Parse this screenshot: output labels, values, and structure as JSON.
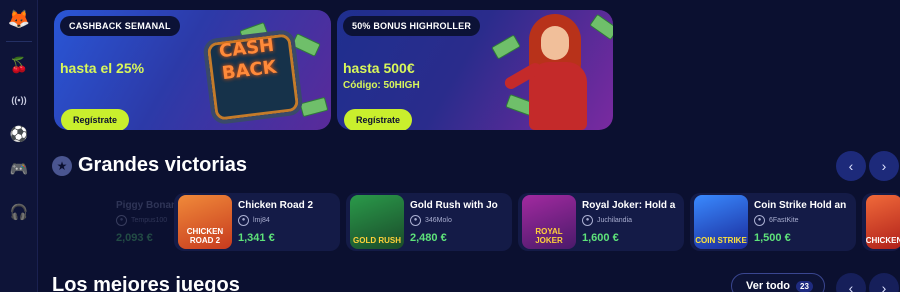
{
  "sidebar": {
    "items": [
      {
        "name": "logo",
        "icon": "🦊"
      },
      {
        "name": "cherries-icon",
        "icon": "🍒"
      },
      {
        "name": "live-icon",
        "icon": "((•))"
      },
      {
        "name": "soccer-icon",
        "icon": "⚽"
      },
      {
        "name": "gamepad-icon",
        "icon": "🎮"
      },
      {
        "name": "headset-icon",
        "icon": "🎧"
      }
    ]
  },
  "promos": [
    {
      "tag": "CASHBACK SEMANAL",
      "headline": "hasta el 25%",
      "sub": "",
      "button": "Regístrate",
      "art_text": "CASH BACK"
    },
    {
      "tag": "50% BONUS HIGHROLLER",
      "headline": "hasta 500€",
      "sub": "Código: 50HIGH",
      "button": "Regístrate"
    }
  ],
  "big_wins": {
    "title": "Grandes victorias",
    "prev": "‹",
    "next": "›",
    "items": [
      {
        "game": "Piggy Bonanza",
        "user": "Tempus100",
        "amount": "2,093 €",
        "thumb_label": "",
        "thumb_color": "#1a2060"
      },
      {
        "game": "Chicken Road 2",
        "user": "lmj84",
        "amount": "1,341 €",
        "thumb_label": "CHICKEN ROAD 2",
        "thumb_color": "#d65a28"
      },
      {
        "game": "Gold Rush with Jo",
        "user": "346Molo",
        "amount": "2,480 €",
        "thumb_label": "GOLD RUSH",
        "thumb_color": "#1d7a3a"
      },
      {
        "game": "Royal Joker: Hold a",
        "user": "Juchilandia",
        "amount": "1,600 €",
        "thumb_label": "ROYAL JOKER",
        "thumb_color": "#7a1d8a"
      },
      {
        "game": "Coin Strike Hold an",
        "user": "6FastKite",
        "amount": "1,500 €",
        "thumb_label": "COIN STRIKE",
        "thumb_color": "#1f6adf"
      },
      {
        "game": "",
        "user": "",
        "amount": "",
        "thumb_label": "CHICKEN",
        "thumb_color": "#d63a2a"
      }
    ]
  },
  "best_games": {
    "title": "Los mejores juegos",
    "view_all": "Ver todo",
    "count": "23",
    "prev": "‹",
    "next": "›"
  },
  "colors": {
    "accent": "#c9ef2d",
    "win": "#5ee27a",
    "bg": "#0b1030"
  }
}
